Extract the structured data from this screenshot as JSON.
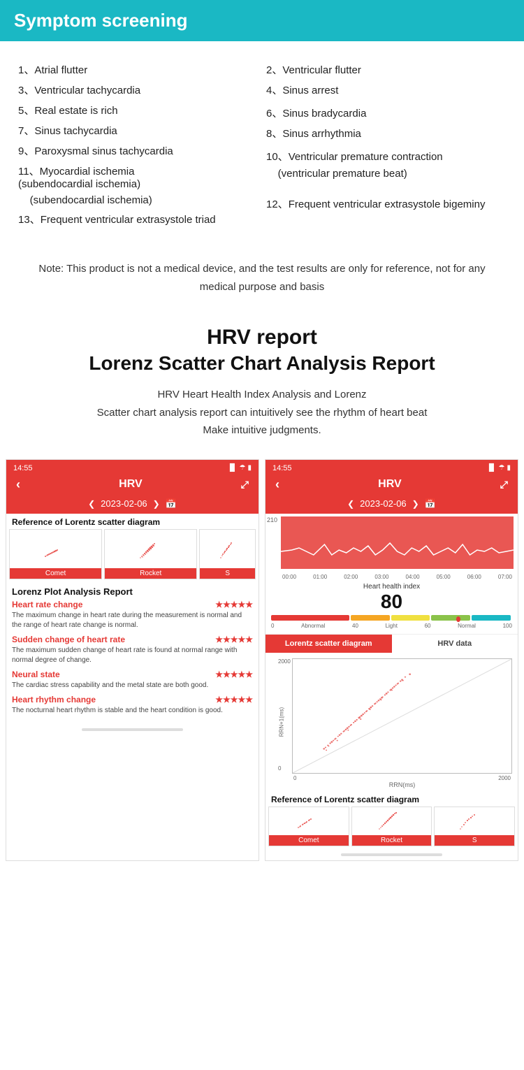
{
  "header": {
    "title": "Symptom screening",
    "bg_color": "#1ab8c4"
  },
  "symptoms": [
    {
      "num": "1、",
      "text": "Atrial flutter",
      "col": 0
    },
    {
      "num": "2、",
      "text": "Ventricular flutter",
      "col": 1
    },
    {
      "num": "3、",
      "text": "Ventricular tachycardia",
      "col": 0
    },
    {
      "num": "4、",
      "text": "Sinus arrest",
      "col": 1
    },
    {
      "num": "5、",
      "text": "Real estate is rich",
      "col": 0
    },
    {
      "num": "6、",
      "text": "Sinus bradycardia",
      "col": 1
    },
    {
      "num": "7、",
      "text": "Sinus tachycardia",
      "col": 0
    },
    {
      "num": "8、",
      "text": "Sinus arrhythmia",
      "col": 1
    },
    {
      "num": "9、",
      "text": "Paroxysmal sinus tachycardia",
      "col": 0
    },
    {
      "num": "10、",
      "text": "Ventricular premature contraction",
      "col": 1
    },
    {
      "num": "11、",
      "text": "Myocardial ischemia\n(subendocardial ischemia)",
      "col": 0
    },
    {
      "num": "10_sub",
      "text": "(ventricular premature beat)",
      "col": 1
    },
    {
      "num": "13、",
      "text": "Frequent ventricular extrasystole triad",
      "col": 0
    },
    {
      "num": "12、",
      "text": "Frequent ventricular extrasystole bigeminy",
      "col": 1
    }
  ],
  "note": {
    "text": "Note: This product is not a medical device, and the test results are only for reference, not for any medical purpose and basis"
  },
  "hrv_report": {
    "title1": "HRV report",
    "title2": "Lorenz Scatter Chart Analysis Report",
    "description": "HRV Heart Health Index Analysis and Lorenz\nScatter chart analysis report can intuitively see the rhythm of heart beat\nMake intuitive judgments."
  },
  "left_phone": {
    "time": "14:55",
    "title": "HRV",
    "date": "2023-02-06",
    "scatter_ref_label": "Reference of Lorentz scatter diagram",
    "thumbnails": [
      {
        "label": "Comet"
      },
      {
        "label": "Rocket"
      },
      {
        "label": "S"
      }
    ],
    "lorenz_title": "Lorenz Plot Analysis Report",
    "metrics": [
      {
        "name": "Heart rate change",
        "stars": "★★★★★",
        "desc": "The maximum change in heart rate during the measurement is normal and the range of heart rate change is normal."
      },
      {
        "name": "Sudden change of heart rate",
        "stars": "★★★★★",
        "desc": "The maximum sudden change of heart rate is found at normal range with normal degree of change."
      },
      {
        "name": "Neural state",
        "stars": "★★★★★",
        "desc": "The cardiac stress capability and the metal state are both good."
      },
      {
        "name": "Heart rhythm change",
        "stars": "★★★★★",
        "desc": "The nocturnal heart rhythm is stable and the heart condition is good."
      }
    ],
    "bottom_bar": ""
  },
  "right_phone": {
    "time": "14:55",
    "title": "HRV",
    "date": "2023-02-06",
    "y_label": "210",
    "time_labels": [
      "00:00",
      "01:00",
      "02:00",
      "03:00",
      "04:00",
      "05:00",
      "06:00",
      "07:00"
    ],
    "heart_index_label": "Heart health index",
    "heart_index_value": "80",
    "bar_labels": [
      "0",
      "Abnormal",
      "40",
      "Light",
      "60",
      "Normal",
      "100"
    ],
    "tab_active": "Lorentz scatter diagram",
    "tab_inactive": "HRV data",
    "scatter_y_labels": [
      "2000",
      "",
      "",
      "",
      "0"
    ],
    "scatter_x_labels": [
      "0",
      "",
      "",
      "",
      "2000"
    ],
    "scatter_x_axis_label": "RRN(ms)",
    "scatter_y_axis_label": "RRN+1(ms)",
    "ref_label": "Reference of Lorentz scatter diagram",
    "bottom_bar": ""
  },
  "colors": {
    "red": "#e53935",
    "teal": "#1ab8c4",
    "white": "#ffffff",
    "light_gray": "#f5f5f5"
  }
}
